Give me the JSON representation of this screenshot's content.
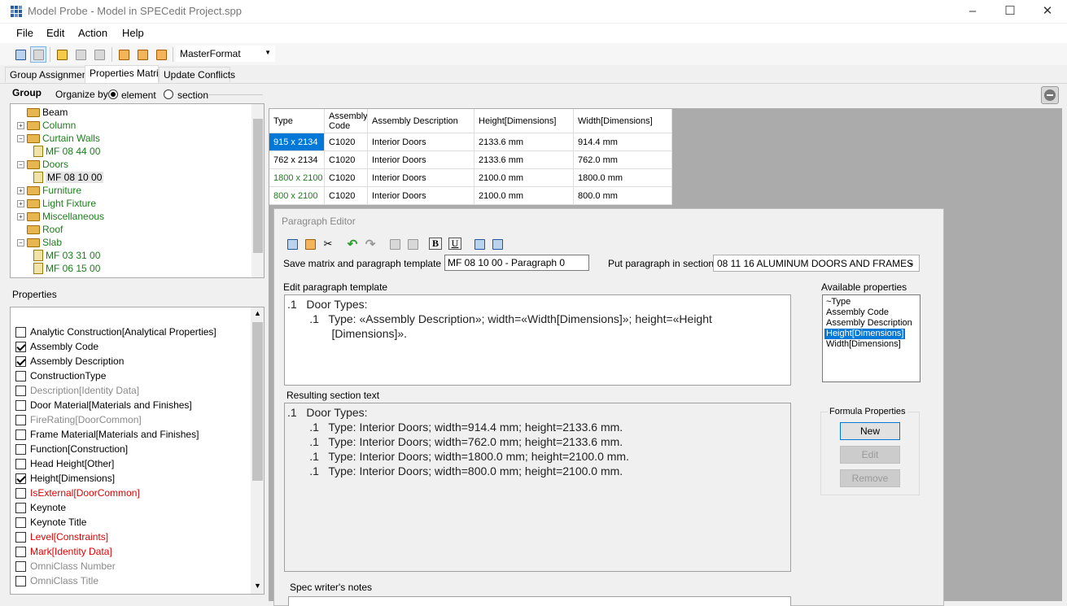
{
  "window": {
    "title": "Model Probe - Model in SPECedit Project.spp",
    "minimize": "–",
    "maximize": "☐",
    "close": "✕"
  },
  "menu": [
    "File",
    "Edit",
    "Action",
    "Help"
  ],
  "toolbar": {
    "format_value": "MasterFormat"
  },
  "tabs": [
    "Group Assignment",
    "Properties Matrix",
    "Update Conflicts"
  ],
  "group_panel": {
    "group_label": "Group",
    "organize_label": "Organize by",
    "radio_element": "element",
    "radio_section": "section",
    "tree": [
      {
        "label": "Beam",
        "color": "#000000",
        "type": "folder",
        "expand": ""
      },
      {
        "label": "Column",
        "color": "#1c7d1c",
        "type": "folder",
        "expand": "+"
      },
      {
        "label": "Curtain Walls",
        "color": "#1c7d1c",
        "type": "folder",
        "expand": "–"
      },
      {
        "label": "MF 08 44 00",
        "color": "#1c7d1c",
        "type": "doc",
        "expand": ""
      },
      {
        "label": "Doors",
        "color": "#1c7d1c",
        "type": "folder",
        "expand": "–"
      },
      {
        "label": "MF 08 10 00",
        "color": "#000000",
        "type": "doc",
        "expand": ""
      },
      {
        "label": "Furniture",
        "color": "#1c7d1c",
        "type": "folder",
        "expand": "+"
      },
      {
        "label": "Light Fixture",
        "color": "#1c7d1c",
        "type": "folder",
        "expand": "+"
      },
      {
        "label": "Miscellaneous",
        "color": "#1c7d1c",
        "type": "folder",
        "expand": "+"
      },
      {
        "label": "Roof",
        "color": "#1c7d1c",
        "type": "folder",
        "expand": ""
      },
      {
        "label": "Slab",
        "color": "#1c7d1c",
        "type": "folder",
        "expand": "–"
      },
      {
        "label": "MF 03 31 00",
        "color": "#1c7d1c",
        "type": "doc",
        "expand": ""
      },
      {
        "label": "MF 06 15 00",
        "color": "#1c7d1c",
        "type": "doc",
        "expand": ""
      }
    ]
  },
  "properties": {
    "title": "Properties",
    "items": [
      {
        "label": "Analytic Construction[Analytical Properties]",
        "checked": false,
        "color": "#000000"
      },
      {
        "label": "Assembly Code",
        "checked": true,
        "color": "#000000"
      },
      {
        "label": "Assembly Description",
        "checked": true,
        "color": "#000000"
      },
      {
        "label": "ConstructionType",
        "checked": false,
        "color": "#000000"
      },
      {
        "label": "Description[Identity Data]",
        "checked": false,
        "color": "#8a8a8a"
      },
      {
        "label": "Door Material[Materials and Finishes]",
        "checked": false,
        "color": "#000000"
      },
      {
        "label": "FireRating[DoorCommon]",
        "checked": false,
        "color": "#8a8a8a"
      },
      {
        "label": "Frame Material[Materials and Finishes]",
        "checked": false,
        "color": "#000000"
      },
      {
        "label": "Function[Construction]",
        "checked": false,
        "color": "#000000"
      },
      {
        "label": "Head Height[Other]",
        "checked": false,
        "color": "#000000"
      },
      {
        "label": "Height[Dimensions]",
        "checked": true,
        "color": "#000000"
      },
      {
        "label": "IsExternal[DoorCommon]",
        "checked": false,
        "color": "#e00000"
      },
      {
        "label": "Keynote",
        "checked": false,
        "color": "#000000"
      },
      {
        "label": "Keynote Title",
        "checked": false,
        "color": "#000000"
      },
      {
        "label": "Level[Constraints]",
        "checked": false,
        "color": "#e00000"
      },
      {
        "label": "Mark[Identity Data]",
        "checked": false,
        "color": "#e00000"
      },
      {
        "label": "OmniClass Number",
        "checked": false,
        "color": "#8a8a8a"
      },
      {
        "label": "OmniClass Title",
        "checked": false,
        "color": "#8a8a8a"
      }
    ]
  },
  "matrix": {
    "headers": [
      "Type",
      "Assembly\nCode",
      "Assembly Description",
      "Height[Dimensions]",
      "Width[Dimensions]"
    ],
    "rows": [
      {
        "type": "915 x 2134",
        "code": "C1020",
        "desc": "Interior Doors",
        "height": "2133.6 mm",
        "width": "914.4 mm",
        "type_color": "#ffffff",
        "selected": true
      },
      {
        "type": "762 x 2134",
        "code": "C1020",
        "desc": "Interior Doors",
        "height": "2133.6 mm",
        "width": "762.0 mm",
        "type_color": "#000000",
        "selected": false
      },
      {
        "type": "1800 x 2100",
        "code": "C1020",
        "desc": "Interior Doors",
        "height": "2100.0 mm",
        "width": "1800.0 mm",
        "type_color": "#1c7d1c",
        "selected": false
      },
      {
        "type": "800 x 2100",
        "code": "C1020",
        "desc": "Interior Doors",
        "height": "2100.0 mm",
        "width": "800.0 mm",
        "type_color": "#1c7d1c",
        "selected": false
      }
    ]
  },
  "editor": {
    "title": "Paragraph Editor",
    "save_label": "Save matrix and paragraph template as:",
    "save_value": "MF 08 10 00 - Paragraph 0",
    "section_label": "Put paragraph in section:",
    "section_value": "08 11 16 ALUMINUM DOORS AND FRAMES",
    "template_label": "Edit paragraph template",
    "template_text": ".1   Door Types:\n       .1   Type: «Assembly Description»; width=«Width[Dimensions]»; height=«Height\n              [Dimensions]».",
    "result_label": "Resulting section text",
    "result_text": ".1   Door Types:\n       .1   Type: Interior Doors; width=914.4 mm; height=2133.6 mm.\n       .1   Type: Interior Doors; width=762.0 mm; height=2133.6 mm.\n       .1   Type: Interior Doors; width=1800.0 mm; height=2100.0 mm.\n       .1   Type: Interior Doors; width=800.0 mm; height=2100.0 mm.",
    "available_label": "Available properties",
    "available": [
      "~Type",
      "Assembly Code",
      "Assembly Description",
      "Height[Dimensions]",
      "Width[Dimensions]"
    ],
    "available_selected": 3,
    "formula_label": "Formula Properties",
    "btn_new": "New",
    "btn_edit": "Edit",
    "btn_remove": "Remove",
    "notes_label": "Spec writer's notes",
    "bold_glyph": "B",
    "underline_glyph": "U"
  }
}
